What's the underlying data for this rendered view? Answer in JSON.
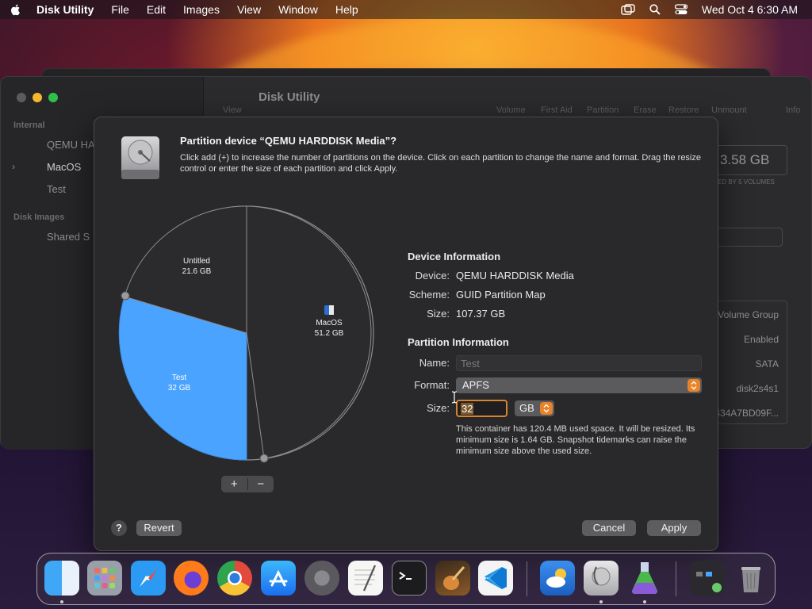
{
  "menubar": {
    "app_name": "Disk Utility",
    "items": [
      "File",
      "Edit",
      "Images",
      "View",
      "Window",
      "Help"
    ],
    "clock": "Wed Oct 4  6:30 AM"
  },
  "background_window": {
    "title": "Disk Utility",
    "sidebar": {
      "internal_header": "Internal",
      "rows": [
        "QEMU HA",
        "MacOS",
        "Test"
      ],
      "disk_images_header": "Disk Images",
      "disk_images_rows": [
        "Shared S"
      ]
    },
    "toolbar": [
      "View",
      "Volume",
      "First Aid",
      "Partition",
      "Erase",
      "Restore",
      "Unmount",
      "Info"
    ],
    "capacity": "3.58 GB",
    "capacity_sub": "ED BY 5 VOLUMES",
    "info_cells": [
      "Volume Group",
      "Enabled",
      "SATA",
      "disk2s4s1",
      "434A7BD09F..."
    ]
  },
  "sheet": {
    "title": "Partition device “QEMU HARDDISK Media”?",
    "description": "Click add (+) to increase the number of partitions on the device. Click on each partition to change the name and format. Drag the resize control or enter the size of each partition and click Apply.",
    "pie": {
      "untitled": {
        "name": "Untitled",
        "size": "21.6 GB",
        "color": "#2b2b2d"
      },
      "macos": {
        "name": "MacOS",
        "size": "51.2 GB",
        "color": "#2b2b2d"
      },
      "test": {
        "name": "Test",
        "size": "32 GB",
        "color": "#4aa3ff"
      }
    },
    "add_label": "+",
    "remove_label": "−",
    "device_info": {
      "heading": "Device Information",
      "device_label": "Device:",
      "device_value": "QEMU HARDDISK Media",
      "scheme_label": "Scheme:",
      "scheme_value": "GUID Partition Map",
      "size_label": "Size:",
      "size_value": "107.37 GB"
    },
    "partition_info": {
      "heading": "Partition Information",
      "name_label": "Name:",
      "name_placeholder": "Test",
      "format_label": "Format:",
      "format_value": "APFS",
      "size_label": "Size:",
      "size_value": "32",
      "unit_value": "GB",
      "note": "This container has 120.4 MB used space. It will be resized. Its minimum size is 1.64 GB. Snapshot tidemarks can raise the minimum size above the used size."
    },
    "help_label": "?",
    "revert_label": "Revert",
    "cancel_label": "Cancel",
    "apply_label": "Apply"
  },
  "dock": {
    "apps": [
      "Finder",
      "Launchpad",
      "Safari",
      "Firefox",
      "Chrome",
      "App Store",
      "System Settings",
      "TextEdit",
      "Terminal",
      "GarageBand",
      "Visual Studio Code",
      "Weather",
      "Disk Utility",
      "Jupyter",
      "Stacks",
      "Trash"
    ]
  },
  "colors": {
    "accent_orange": "#e8832a",
    "partition_blue": "#4aa3ff"
  }
}
